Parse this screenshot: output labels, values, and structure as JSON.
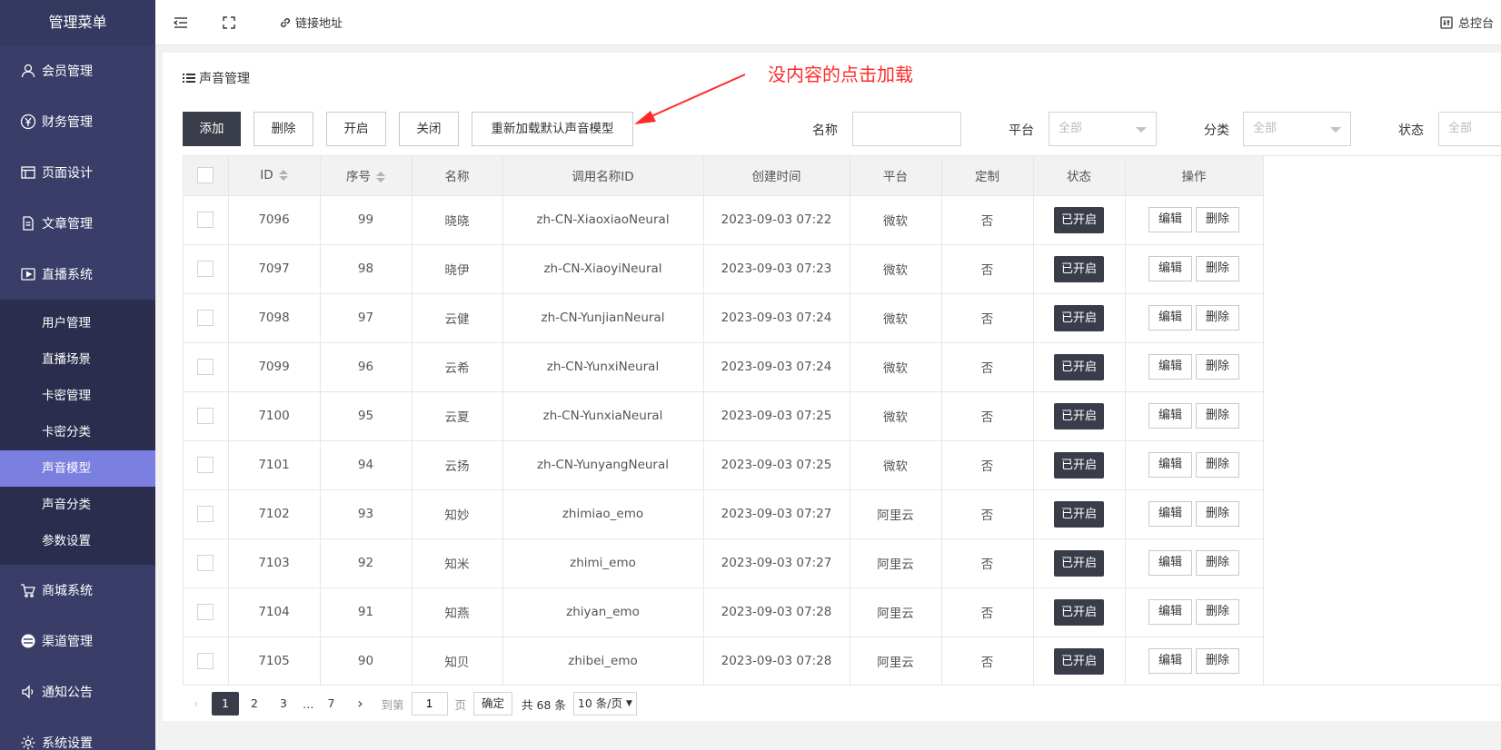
{
  "sidebar": {
    "title": "管理菜单",
    "items": [
      {
        "label": "会员管理",
        "icon": "user-icon"
      },
      {
        "label": "财务管理",
        "icon": "yen-icon"
      },
      {
        "label": "页面设计",
        "icon": "layout-icon"
      },
      {
        "label": "文章管理",
        "icon": "document-icon"
      },
      {
        "label": "直播系统",
        "icon": "video-icon"
      }
    ],
    "sub_items": [
      {
        "label": "用户管理"
      },
      {
        "label": "直播场景"
      },
      {
        "label": "卡密管理"
      },
      {
        "label": "卡密分类"
      },
      {
        "label": "声音模型",
        "active": true
      },
      {
        "label": "声音分类"
      },
      {
        "label": "参数设置"
      }
    ],
    "items_after": [
      {
        "label": "商城系统",
        "icon": "cart-icon"
      },
      {
        "label": "渠道管理",
        "icon": "channel-icon"
      },
      {
        "label": "通知公告",
        "icon": "speaker-icon"
      },
      {
        "label": "系统设置",
        "icon": "gear-icon"
      }
    ]
  },
  "topbar": {
    "link_label": "链接地址",
    "dashboard_label": "总控台"
  },
  "page": {
    "title": "声音管理",
    "annotation": "没内容的点击加载",
    "annotation_color": "#ff2a2a"
  },
  "toolbar": {
    "add": "添加",
    "delete": "删除",
    "enable": "开启",
    "disable": "关闭",
    "reload": "重新加载默认声音模型"
  },
  "filters": {
    "name_label": "名称",
    "name_value": "",
    "platform_label": "平台",
    "platform_value": "全部",
    "category_label": "分类",
    "category_value": "全部",
    "status_label": "状态",
    "status_value": "全部"
  },
  "table": {
    "headers": [
      "ID",
      "序号",
      "名称",
      "调用名称ID",
      "创建时间",
      "平台",
      "定制",
      "状态",
      "操作"
    ],
    "status_label": "已开启",
    "edit_label": "编辑",
    "delete_label": "删除",
    "rows": [
      {
        "id": "7096",
        "seq": "99",
        "name": "晓晓",
        "call_id": "zh-CN-XiaoxiaoNeural",
        "created": "2023-09-03 07:22",
        "platform": "微软",
        "custom": "否"
      },
      {
        "id": "7097",
        "seq": "98",
        "name": "晓伊",
        "call_id": "zh-CN-XiaoyiNeural",
        "created": "2023-09-03 07:23",
        "platform": "微软",
        "custom": "否"
      },
      {
        "id": "7098",
        "seq": "97",
        "name": "云健",
        "call_id": "zh-CN-YunjianNeural",
        "created": "2023-09-03 07:24",
        "platform": "微软",
        "custom": "否"
      },
      {
        "id": "7099",
        "seq": "96",
        "name": "云希",
        "call_id": "zh-CN-YunxiNeural",
        "created": "2023-09-03 07:24",
        "platform": "微软",
        "custom": "否"
      },
      {
        "id": "7100",
        "seq": "95",
        "name": "云夏",
        "call_id": "zh-CN-YunxiaNeural",
        "created": "2023-09-03 07:25",
        "platform": "微软",
        "custom": "否"
      },
      {
        "id": "7101",
        "seq": "94",
        "name": "云扬",
        "call_id": "zh-CN-YunyangNeural",
        "created": "2023-09-03 07:25",
        "platform": "微软",
        "custom": "否"
      },
      {
        "id": "7102",
        "seq": "93",
        "name": "知妙",
        "call_id": "zhimiao_emo",
        "created": "2023-09-03 07:27",
        "platform": "阿里云",
        "custom": "否"
      },
      {
        "id": "7103",
        "seq": "92",
        "name": "知米",
        "call_id": "zhimi_emo",
        "created": "2023-09-03 07:27",
        "platform": "阿里云",
        "custom": "否"
      },
      {
        "id": "7104",
        "seq": "91",
        "name": "知燕",
        "call_id": "zhiyan_emo",
        "created": "2023-09-03 07:28",
        "platform": "阿里云",
        "custom": "否"
      },
      {
        "id": "7105",
        "seq": "90",
        "name": "知贝",
        "call_id": "zhibei_emo",
        "created": "2023-09-03 07:28",
        "platform": "阿里云",
        "custom": "否"
      }
    ]
  },
  "pager": {
    "pages": [
      "1",
      "2",
      "3",
      "…",
      "7"
    ],
    "current": "1",
    "goto_label": "到第",
    "goto_value": "1",
    "page_unit": "页",
    "confirm": "确定",
    "total": "共 68 条",
    "page_size": "10 条/页"
  }
}
